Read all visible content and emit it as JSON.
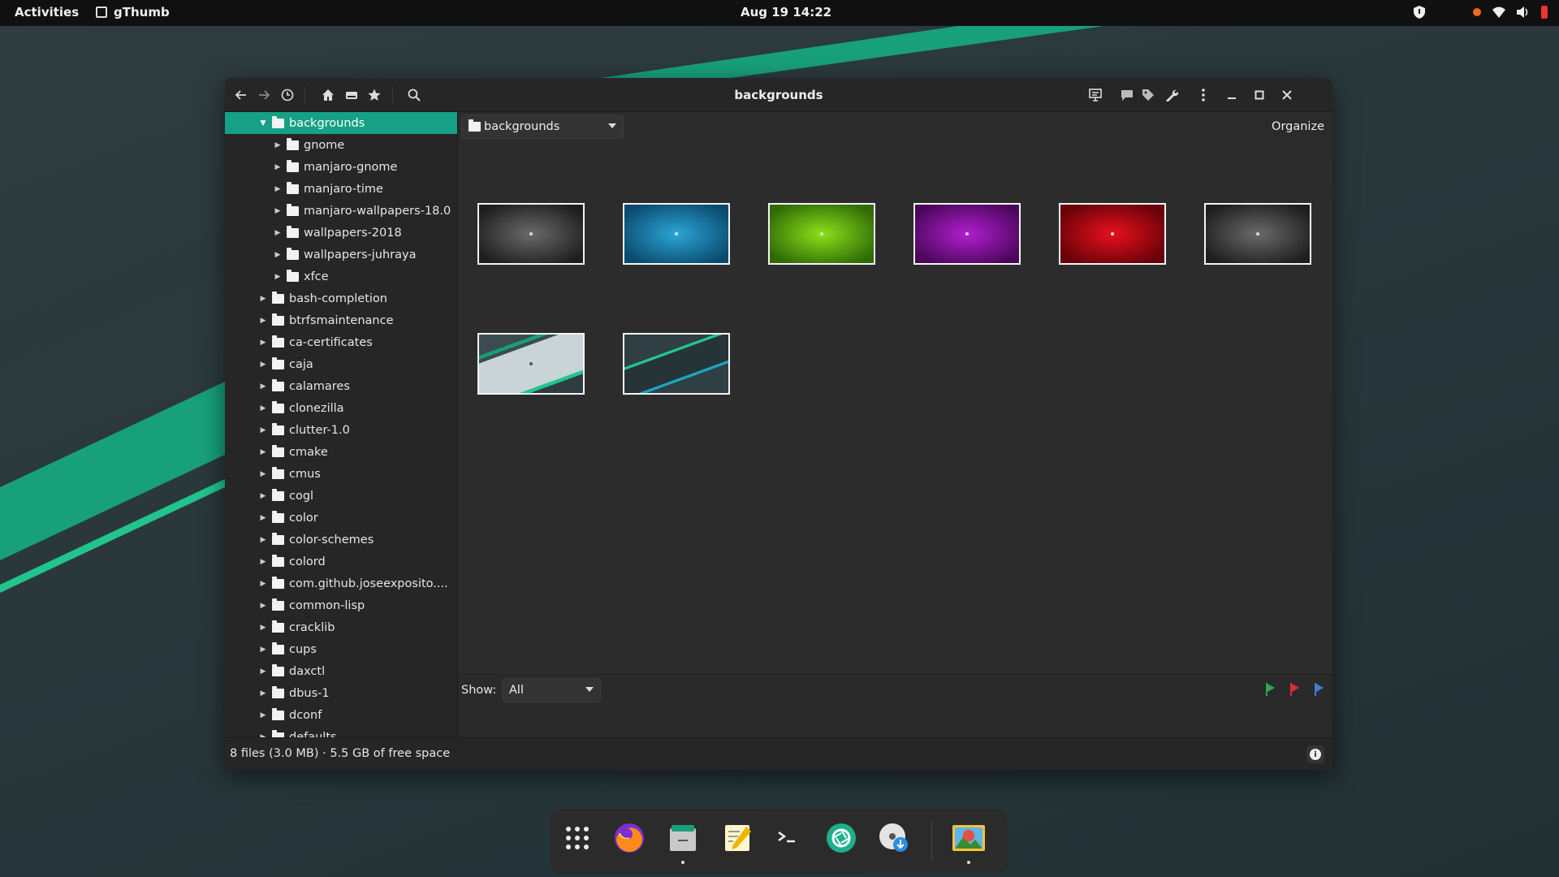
{
  "topbar": {
    "activities": "Activities",
    "app_name": "gThumb",
    "clock": "Aug 19  14:22"
  },
  "window": {
    "title": "backgrounds"
  },
  "sidebar": {
    "items": [
      {
        "label": "backgrounds",
        "expanded": true,
        "selected": true,
        "level": 0
      },
      {
        "label": "gnome",
        "level": 1
      },
      {
        "label": "manjaro-gnome",
        "level": 1
      },
      {
        "label": "manjaro-time",
        "level": 1
      },
      {
        "label": "manjaro-wallpapers-18.0",
        "level": 1
      },
      {
        "label": "wallpapers-2018",
        "level": 1
      },
      {
        "label": "wallpapers-juhraya",
        "level": 1
      },
      {
        "label": "xfce",
        "level": 1
      },
      {
        "label": "bash-completion",
        "level": 0
      },
      {
        "label": "btrfsmaintenance",
        "level": 0
      },
      {
        "label": "ca-certificates",
        "level": 0
      },
      {
        "label": "caja",
        "level": 0
      },
      {
        "label": "calamares",
        "level": 0
      },
      {
        "label": "clonezilla",
        "level": 0
      },
      {
        "label": "clutter-1.0",
        "level": 0
      },
      {
        "label": "cmake",
        "level": 0
      },
      {
        "label": "cmus",
        "level": 0
      },
      {
        "label": "cogl",
        "level": 0
      },
      {
        "label": "color",
        "level": 0
      },
      {
        "label": "color-schemes",
        "level": 0
      },
      {
        "label": "colord",
        "level": 0
      },
      {
        "label": "com.github.joseexposito....",
        "level": 0
      },
      {
        "label": "common-lisp",
        "level": 0
      },
      {
        "label": "cracklib",
        "level": 0
      },
      {
        "label": "cups",
        "level": 0
      },
      {
        "label": "daxctl",
        "level": 0
      },
      {
        "label": "dbus-1",
        "level": 0
      },
      {
        "label": "dconf",
        "level": 0
      },
      {
        "label": "defaults",
        "level": 0
      }
    ]
  },
  "location": {
    "current": "backgrounds",
    "organize_label": "Organize"
  },
  "thumbnails": [
    {
      "style": "dark-radial",
      "colors": [
        "#6a6a6a",
        "#1e1e1e"
      ]
    },
    {
      "style": "blue-radial",
      "colors": [
        "#2aa6d6",
        "#0b4a6e"
      ]
    },
    {
      "style": "green-radial",
      "colors": [
        "#8ee01a",
        "#2f6a05"
      ]
    },
    {
      "style": "purple-radial",
      "colors": [
        "#b11ed0",
        "#4a075a"
      ]
    },
    {
      "style": "red-radial",
      "colors": [
        "#e8101e",
        "#660208"
      ]
    },
    {
      "style": "dark-radial",
      "colors": [
        "#6a6a6a",
        "#1e1e1e"
      ]
    },
    {
      "style": "light-stripes",
      "colors": [
        "#c8d4d6",
        "#16a07a"
      ]
    },
    {
      "style": "dark-stripes",
      "colors": [
        "#2f3f44",
        "#22c48d"
      ]
    }
  ],
  "filter": {
    "show_label": "Show:",
    "show_value": "All"
  },
  "flags": {
    "green": "#2ea84a",
    "red": "#d9302e",
    "blue": "#3b7fd1"
  },
  "status": {
    "text": "8 files (3.0 MB)  ·  5.5 GB of free space"
  },
  "dock": {
    "apps": [
      "app-grid-icon",
      "firefox-icon",
      "files-icon",
      "text-editor-icon",
      "terminal-icon",
      "camera-icon",
      "disk-installer-icon",
      "gthumb-icon"
    ]
  }
}
